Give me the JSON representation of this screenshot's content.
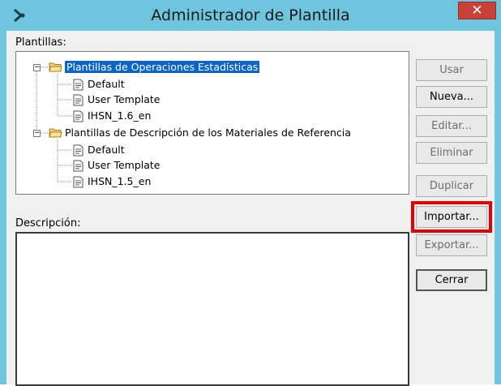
{
  "window": {
    "title": "Administrador de Plantilla",
    "close_glyph": "✕"
  },
  "labels": {
    "templates": "Plantillas:",
    "description": "Descripción:"
  },
  "tree": [
    {
      "name": "Plantillas de Operaciones Estadísticas",
      "expanded": true,
      "selected": true,
      "children": [
        "Default",
        "User Template",
        "IHSN_1.6_en"
      ]
    },
    {
      "name": "Plantillas de Descripción de los Materiales de Referencia",
      "expanded": true,
      "selected": false,
      "children": [
        "Default",
        "User Template",
        "IHSN_1.5_en"
      ]
    }
  ],
  "expander_glyph": "−",
  "description_text": "",
  "buttons": {
    "usar": "Usar",
    "nueva": "Nueva...",
    "editar": "Editar...",
    "eliminar": "Eliminar",
    "duplicar": "Duplicar",
    "importar": "Importar...",
    "exportar": "Exportar...",
    "cerrar": "Cerrar"
  },
  "colors": {
    "title_bar": "#6fc5dd",
    "selection": "#0a64c9",
    "highlight_frame": "#e60000",
    "close_button": "#c7413a"
  }
}
